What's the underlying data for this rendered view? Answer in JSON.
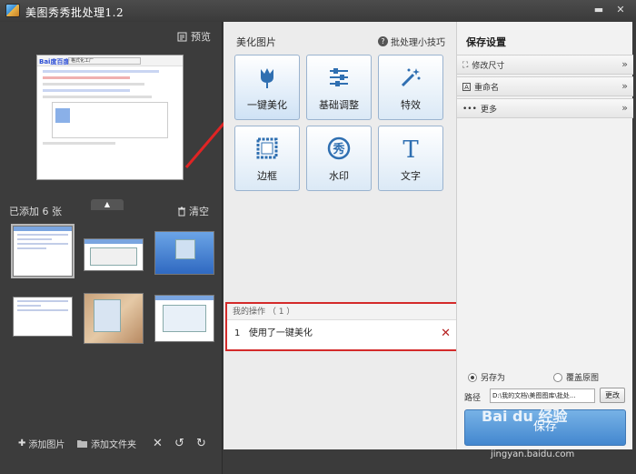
{
  "window": {
    "title": "美图秀秀批处理1.2",
    "min": "▬",
    "close": "✕"
  },
  "left": {
    "preview_label": "预览",
    "preview_thumb": {
      "logo": "Bai度百度",
      "search": "格式化工厂"
    },
    "added_label": "已添加 6 张",
    "clear_label": "清空",
    "footer": {
      "add_image": "添加图片",
      "add_folder": "添加文件夹"
    }
  },
  "center": {
    "title": "美化图片",
    "tips": "批处理小技巧",
    "tiles": [
      {
        "label": "一键美化",
        "icon": "tulip-icon"
      },
      {
        "label": "基础调整",
        "icon": "sliders-icon"
      },
      {
        "label": "特效",
        "icon": "magic-wand-icon"
      },
      {
        "label": "边框",
        "icon": "frame-icon"
      },
      {
        "label": "水印",
        "icon": "watermark-icon"
      },
      {
        "label": "文字",
        "icon": "text-icon"
      }
    ],
    "operations": {
      "header": "我的操作 （ 1 ）",
      "items": [
        {
          "index": "1",
          "text": "使用了一键美化"
        }
      ]
    },
    "accent_color": "#d42a2a"
  },
  "right": {
    "title": "保存设置",
    "rows": [
      {
        "label": "修改尺寸"
      },
      {
        "label": "重命名"
      },
      {
        "label": "更多"
      }
    ],
    "options": {
      "save_as": "另存为",
      "overwrite": "覆盖原图"
    },
    "path_label": "路径",
    "path_value": "D:\\我的文档\\美图图库\\批处...",
    "change_label": "更改",
    "save_label": "保存"
  },
  "watermark": {
    "brand": "Bai du 经验",
    "url": "jingyan.baidu.com"
  }
}
